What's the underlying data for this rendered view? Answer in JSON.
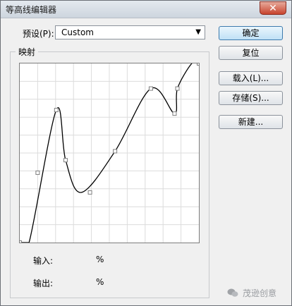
{
  "window": {
    "title": "等高线编辑器",
    "close_icon": "close-icon"
  },
  "preset": {
    "label": "预设(P):",
    "value": "Custom"
  },
  "mapping": {
    "group_title": "映射"
  },
  "readout": {
    "input_label": "输入:",
    "output_label": "输出:",
    "input_unit": "%",
    "output_unit": "%"
  },
  "buttons": {
    "ok": "确定",
    "reset": "复位",
    "load": "载入(L)...",
    "save": "存储(S)...",
    "new": "新建..."
  },
  "watermark": {
    "text": "茂逊创意",
    "icon": "wechat-icon"
  },
  "curve": {
    "points": [
      [
        0,
        0
      ],
      [
        13,
        0
      ],
      [
        51,
        74
      ],
      [
        64,
        46
      ],
      [
        86,
        28
      ],
      [
        133,
        51
      ],
      [
        183,
        86
      ],
      [
        216,
        72
      ],
      [
        220,
        86
      ],
      [
        240,
        100
      ],
      [
        250,
        100
      ]
    ],
    "anchor_points": [
      [
        0,
        0
      ],
      [
        25,
        39
      ],
      [
        51,
        74
      ],
      [
        64,
        46
      ],
      [
        98,
        28
      ],
      [
        133,
        51
      ],
      [
        183,
        86
      ],
      [
        216,
        72
      ],
      [
        220,
        86
      ],
      [
        250,
        100
      ]
    ],
    "colors": {
      "curve": "#000000",
      "grid": "#dcdcdc",
      "anchor": "#7d7d7d"
    }
  }
}
